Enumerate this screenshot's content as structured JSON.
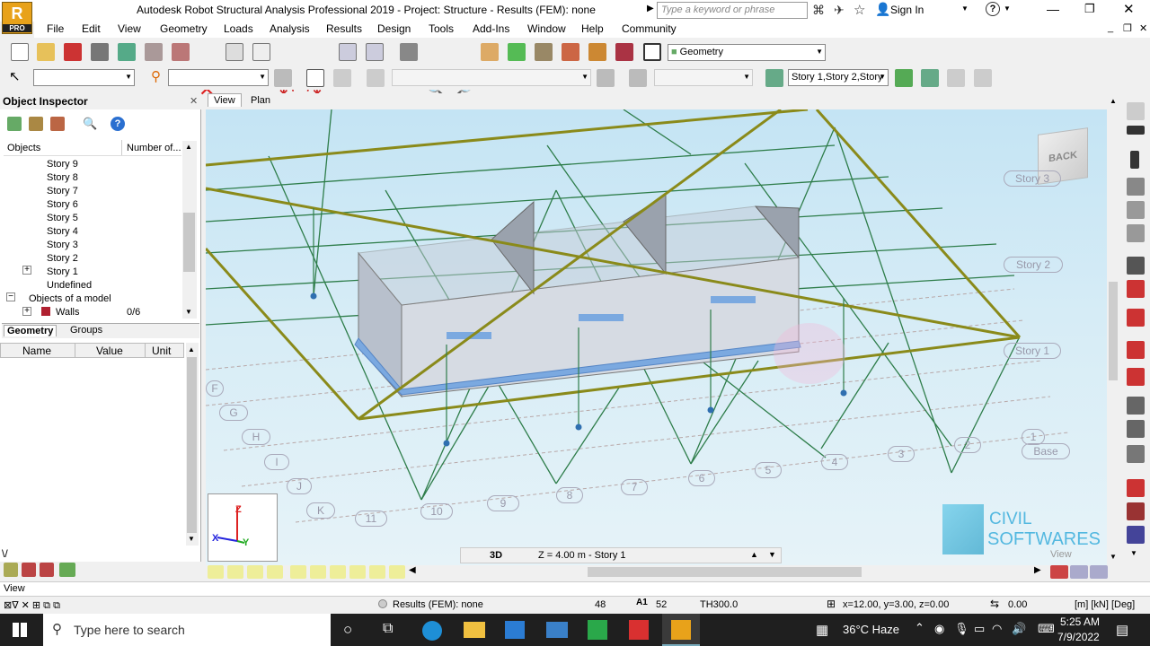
{
  "app": {
    "title": "Autodesk Robot Structural Analysis Professional 2019 - Project: Structure - Results (FEM): none",
    "logo_letter": "R",
    "logo_sub": "PRO",
    "search_placeholder": "Type a keyword or phrase",
    "sign_in": "Sign In"
  },
  "menu": [
    "File",
    "Edit",
    "View",
    "Geometry",
    "Loads",
    "Analysis",
    "Results",
    "Design",
    "Tools",
    "Add-Ins",
    "Window",
    "Help",
    "Community"
  ],
  "toolbar": {
    "layout_combo": "Geometry",
    "story_combo": "Story 1,Story 2,Story"
  },
  "inspector": {
    "title": "Object Inspector",
    "col_objects": "Objects",
    "col_number": "Number of...",
    "tree": [
      {
        "label": "Story 9",
        "count": ""
      },
      {
        "label": "Story 8",
        "count": ""
      },
      {
        "label": "Story 7",
        "count": ""
      },
      {
        "label": "Story 6",
        "count": ""
      },
      {
        "label": "Story 5",
        "count": ""
      },
      {
        "label": "Story 4",
        "count": ""
      },
      {
        "label": "Story 3",
        "count": ""
      },
      {
        "label": "Story 2",
        "count": ""
      },
      {
        "label": "Story 1",
        "count": ""
      },
      {
        "label": "Undefined",
        "count": ""
      },
      {
        "label": "Objects of a model",
        "count": ""
      },
      {
        "label": "Walls",
        "count": "0/6"
      }
    ],
    "tabs": [
      "Geometry",
      "Groups"
    ],
    "prop_cols": [
      "Name",
      "Value",
      "Unit"
    ]
  },
  "view_tabs": [
    "View",
    "Plan"
  ],
  "viewport": {
    "cube_label": "BACK",
    "story_labels": [
      "Story 3",
      "Story 2",
      "Story 1",
      "Base"
    ],
    "grid_letters": [
      "F",
      "G",
      "H",
      "I",
      "J",
      "K"
    ],
    "grid_numbers": [
      "11",
      "10",
      "9",
      "8",
      "7",
      "6",
      "5",
      "4",
      "3",
      "2",
      "1"
    ],
    "status_mode": "3D",
    "status_level": "Z = 4.00 m - Story 1",
    "watermark_line1": "CIVIL",
    "watermark_line2": "SOFTWARES",
    "watermark_sub": "View"
  },
  "status": {
    "view_label": "View",
    "results": "Results (FEM): none",
    "nodes": "48",
    "bars": "52",
    "section": "TH300.0",
    "coords": "x=12.00, y=3.00, z=0.00",
    "angle": "0.00",
    "units": "[m] [kN] [Deg]"
  },
  "taskbar": {
    "search_placeholder": "Type here to search",
    "weather": "36°C  Haze",
    "time": "5:25 AM",
    "date": "7/9/2022"
  },
  "colors": {
    "accent_olive": "#8a8a1a",
    "grid_green": "#2e7d4a",
    "wall_fill": "#c8d0dc",
    "viewport_bg": "#cfe8f4"
  }
}
